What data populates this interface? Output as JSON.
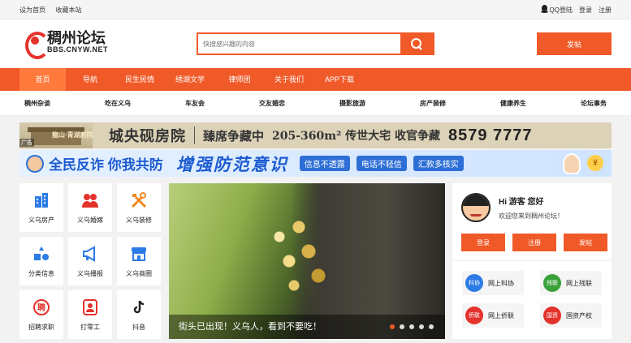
{
  "topbar": {
    "set_home": "设为首页",
    "bookmark": "收藏本站",
    "qq_login": "QQ登陆",
    "login": "登录",
    "register": "注册"
  },
  "header": {
    "logo_cn": "稠州论坛",
    "logo_en": "BBS.CNYW.NET",
    "search_placeholder": "快搜感兴趣的内容",
    "post_button": "发帖"
  },
  "nav": {
    "items": [
      "首页",
      "导航",
      "民生民情",
      "绣湖文学",
      "律师团",
      "关于我们",
      "APP下载"
    ],
    "active_index": 0
  },
  "subnav": {
    "items": [
      "稠州杂谈",
      "吃在义乌",
      "车友会",
      "交友婚恋",
      "摄影旅游",
      "房产装修",
      "健康养生",
      "论坛事务"
    ]
  },
  "banners": {
    "banner1": {
      "ad_tag": "广告",
      "brand": "龍山·青湖府院",
      "title": "城央砚房院",
      "middle": "臻席争藏中",
      "phone": "8579 7777",
      "detail": "205-360m² 传世大宅 收官争藏"
    },
    "banner2": {
      "slogan": "全民反诈 你我共防",
      "main": "增强防范意识",
      "tags": [
        "信息不透露",
        "电话不轻信",
        "汇款多核实"
      ],
      "coin": "¥"
    }
  },
  "grid": {
    "tiles": [
      {
        "label": "义乌房产",
        "icon": "building-icon",
        "color": "#2d7be6"
      },
      {
        "label": "义乌婚嫁",
        "icon": "couple-icon",
        "color": "#e4332c"
      },
      {
        "label": "义乌装修",
        "icon": "tools-icon",
        "color": "#f08a24"
      },
      {
        "label": "分类信息",
        "icon": "category-icon",
        "color": "#2d7be6"
      },
      {
        "label": "义乌播报",
        "icon": "megaphone-icon",
        "color": "#2d7be6"
      },
      {
        "label": "义乌商圈",
        "icon": "shop-icon",
        "color": "#2d7be6"
      },
      {
        "label": "招聘求职",
        "icon": "recruit-icon",
        "color": "#e4332c"
      },
      {
        "label": "打零工",
        "icon": "worker-icon",
        "color": "#e4332c"
      },
      {
        "label": "抖音",
        "icon": "tiktok-icon",
        "color": "#222222"
      }
    ]
  },
  "slider": {
    "caption": "街头已出现！义乌人，看到不要吃！",
    "dot_count": 5,
    "active_dot": 0
  },
  "side": {
    "greeting": "Hi 游客 您好",
    "welcome": "欢迎您来到稠州论坛！",
    "login": "登录",
    "register": "注册",
    "post": "发帖",
    "services": [
      {
        "name": "网上科协",
        "badge": "科协",
        "color": "#2d7be6"
      },
      {
        "name": "网上残联",
        "badge": "残联",
        "color": "#3aa13a"
      },
      {
        "name": "网上侨联",
        "badge": "侨联",
        "color": "#e4332c"
      },
      {
        "name": "国资产权",
        "badge": "国资",
        "color": "#e4332c"
      }
    ]
  },
  "colors": {
    "accent": "#f05a28",
    "nav_active": "#ff7a3c"
  }
}
